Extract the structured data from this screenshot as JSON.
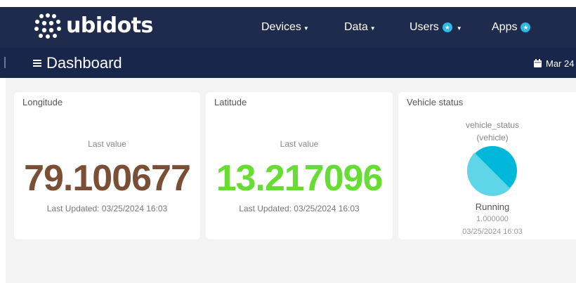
{
  "brand": {
    "name": "ubidots"
  },
  "nav": {
    "devices": "Devices",
    "data": "Data",
    "users": "Users",
    "apps": "Apps",
    "badge_color": "#2bbbe8"
  },
  "subheader": {
    "title": "Dashboard",
    "date": "Mar 24"
  },
  "widgets": {
    "longitude": {
      "title": "Longitude",
      "label": "Last value",
      "value": "79.100677",
      "updated": "Last Updated: 03/25/2024 16:03",
      "color": "#7a4f35"
    },
    "latitude": {
      "title": "Latitude",
      "label": "Last value",
      "value": "13.217096",
      "updated": "Last Updated: 03/25/2024 16:03",
      "color": "#66dd33"
    },
    "vehicle_status": {
      "title": "Vehicle status",
      "variable": "vehicle_status",
      "device": "(vehicle)",
      "status": "Running",
      "value": "1.000000",
      "timestamp": "03/25/2024 16:03",
      "pie_colors": [
        "#00b8d9",
        "#5fd6e8"
      ]
    }
  },
  "colors": {
    "topbar": "#1f2b4d",
    "subbar": "#17264a",
    "background": "#f3f3f3"
  }
}
